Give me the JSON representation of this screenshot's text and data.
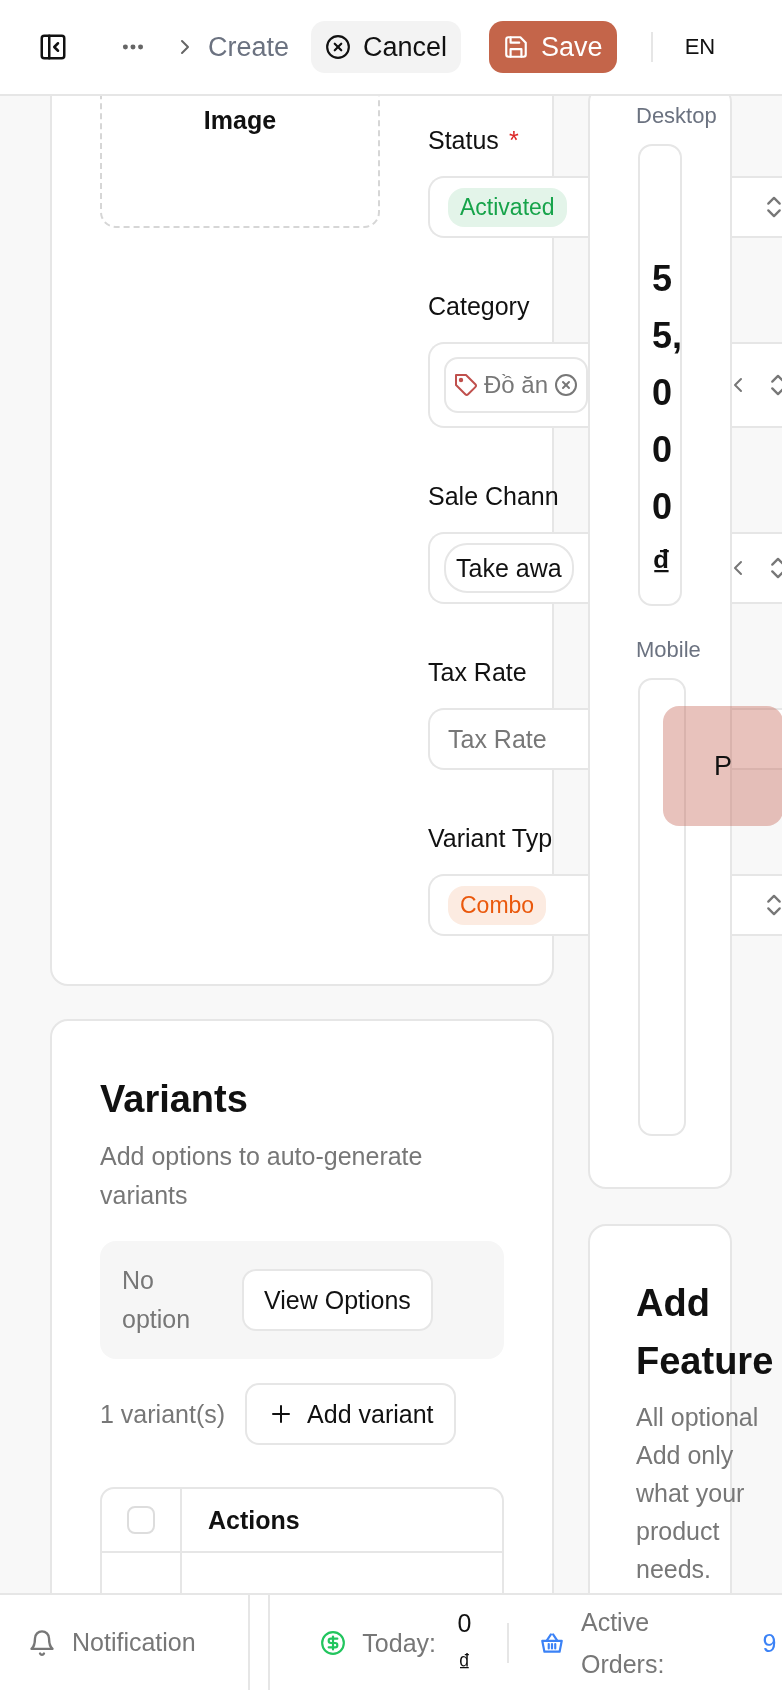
{
  "header": {
    "breadcrumb": "Create",
    "cancel": "Cancel",
    "save": "Save",
    "language": "EN"
  },
  "media": {
    "label": "Image"
  },
  "fields": [
    {
      "label": "Status",
      "required_mark": "*",
      "kind": "badge",
      "value": "Activated",
      "color": "#16a34a"
    },
    {
      "label": "Category",
      "kind": "tag",
      "value": "Đồ ăn"
    },
    {
      "label": "Sale Chann",
      "kind": "chip",
      "value": "Take awa"
    },
    {
      "label": "Tax Rate",
      "kind": "input",
      "placeholder": "Tax Rate"
    },
    {
      "label": "Variant Typ",
      "kind": "badge",
      "value": "Combo",
      "color": "#ea580c"
    }
  ],
  "preview": {
    "desktop_label": "Desktop",
    "price": "55,000₫",
    "mobile_label": "Mobile",
    "avatar": "P"
  },
  "variants": {
    "title": "Variants",
    "subtitle": "Add options to auto-generate variants",
    "empty": "No option",
    "view_button": "View Options",
    "count": "1 variant(s)",
    "add_button": "Add variant",
    "columns": [
      "Actions"
    ],
    "header_checked": false
  },
  "features": {
    "title": "Add Feature",
    "text": "All optional Add only what your product needs."
  },
  "status_bar": {
    "notification": "Notification",
    "stats": [
      {
        "kind": "revenue",
        "label": "Today:",
        "value": "0 ₫"
      },
      {
        "kind": "orders",
        "label": "Active Orders:",
        "value": "9"
      }
    ]
  }
}
